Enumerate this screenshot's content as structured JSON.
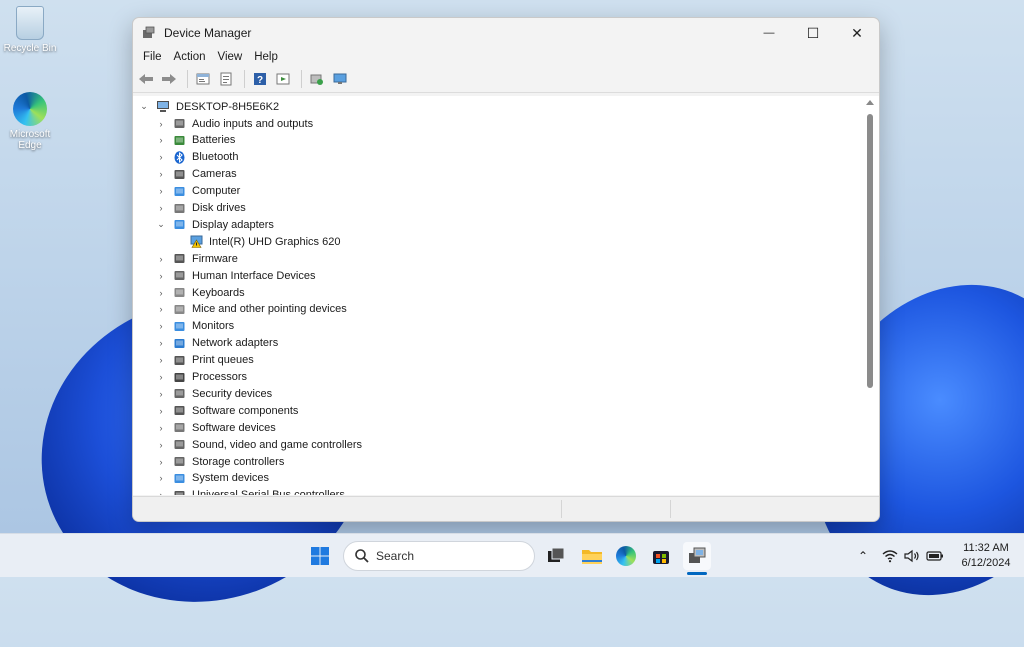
{
  "desktop": {
    "icons": [
      {
        "label": "Recycle Bin"
      },
      {
        "label": "Microsoft Edge"
      }
    ]
  },
  "window": {
    "title": "Device Manager",
    "controls": {
      "minimize": "—",
      "maximize": "☐",
      "close": "✕"
    },
    "menu": [
      "File",
      "Action",
      "View",
      "Help"
    ],
    "toolbar_icons": [
      "back-icon",
      "forward-icon",
      "properties-icon",
      "show-hide-icon",
      "help-icon",
      "run-icon",
      "scan-hardware-icon",
      "monitor-icon"
    ]
  },
  "tree": {
    "root": "DESKTOP-8H5E6K2",
    "items": [
      {
        "label": "Audio inputs and outputs",
        "expanded": false,
        "icon": "speaker-icon"
      },
      {
        "label": "Batteries",
        "expanded": false,
        "icon": "battery-icon"
      },
      {
        "label": "Bluetooth",
        "expanded": false,
        "icon": "bluetooth-icon"
      },
      {
        "label": "Cameras",
        "expanded": false,
        "icon": "camera-icon"
      },
      {
        "label": "Computer",
        "expanded": false,
        "icon": "computer-icon"
      },
      {
        "label": "Disk drives",
        "expanded": false,
        "icon": "disk-icon"
      },
      {
        "label": "Display adapters",
        "expanded": true,
        "icon": "display-adapter-icon"
      },
      {
        "label": "Intel(R) UHD Graphics 620",
        "child": true,
        "icon": "warning-display-icon"
      },
      {
        "label": "Firmware",
        "expanded": false,
        "icon": "firmware-icon"
      },
      {
        "label": "Human Interface Devices",
        "expanded": false,
        "icon": "hid-icon"
      },
      {
        "label": "Keyboards",
        "expanded": false,
        "icon": "keyboard-icon"
      },
      {
        "label": "Mice and other pointing devices",
        "expanded": false,
        "icon": "mouse-icon"
      },
      {
        "label": "Monitors",
        "expanded": false,
        "icon": "monitor-icon"
      },
      {
        "label": "Network adapters",
        "expanded": false,
        "icon": "network-icon"
      },
      {
        "label": "Print queues",
        "expanded": false,
        "icon": "printer-icon"
      },
      {
        "label": "Processors",
        "expanded": false,
        "icon": "processor-icon"
      },
      {
        "label": "Security devices",
        "expanded": false,
        "icon": "security-icon"
      },
      {
        "label": "Software components",
        "expanded": false,
        "icon": "software-component-icon"
      },
      {
        "label": "Software devices",
        "expanded": false,
        "icon": "software-device-icon"
      },
      {
        "label": "Sound, video and game controllers",
        "expanded": false,
        "icon": "sound-icon"
      },
      {
        "label": "Storage controllers",
        "expanded": false,
        "icon": "storage-icon"
      },
      {
        "label": "System devices",
        "expanded": false,
        "icon": "system-icon"
      },
      {
        "label": "Universal Serial Bus controllers",
        "expanded": false,
        "icon": "usb-icon"
      }
    ]
  },
  "taskbar": {
    "search_placeholder": "Search",
    "apps": [
      "start-icon",
      "search-icon",
      "task-view-icon",
      "file-explorer-icon",
      "edge-icon",
      "store-icon",
      "device-manager-icon"
    ],
    "tray": [
      "chevron-up-icon",
      "wifi-icon",
      "volume-icon",
      "battery-icon"
    ],
    "time": "11:32 AM",
    "date": "6/12/2024"
  },
  "colors": {
    "accent": "#0067c0",
    "warning": "#f2c200",
    "selection": "#cce8ff"
  }
}
